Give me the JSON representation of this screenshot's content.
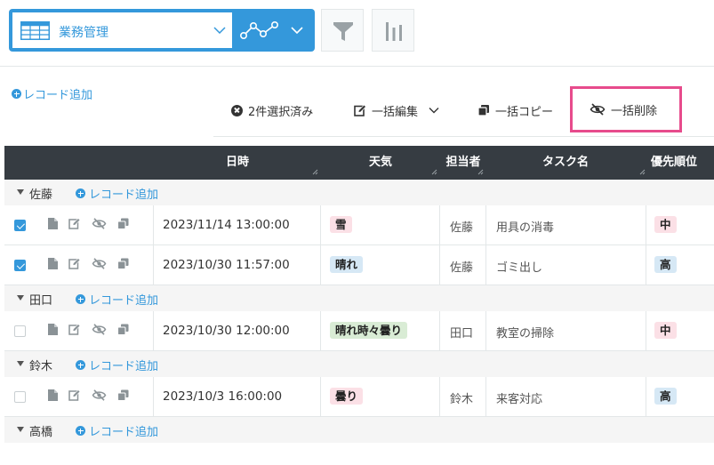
{
  "toolbar": {
    "view_name": "業務管理"
  },
  "add_record_label": "レコード追加",
  "bulk_actions": {
    "selected": "2件選択済み",
    "edit": "一括編集",
    "copy": "一括コピー",
    "delete": "一括削除"
  },
  "table": {
    "columns": [
      "日時",
      "天気",
      "担当者",
      "タスク名",
      "優先順位"
    ],
    "groups": [
      {
        "name": "佐藤",
        "add_label": "レコード追加",
        "rows": [
          {
            "checked": true,
            "datetime": "2023/11/14 13:00:00",
            "weather": "雪",
            "weather_color": "#fbe0e6",
            "person": "佐藤",
            "task": "用具の消毒",
            "priority": "中",
            "priority_color": "#fbe0e6"
          },
          {
            "checked": true,
            "datetime": "2023/10/30 11:57:00",
            "weather": "晴れ",
            "weather_color": "#d6e8f5",
            "person": "佐藤",
            "task": "ゴミ出し",
            "priority": "高",
            "priority_color": "#d6e8f5"
          }
        ]
      },
      {
        "name": "田口",
        "add_label": "レコード追加",
        "rows": [
          {
            "checked": false,
            "datetime": "2023/10/30 12:00:00",
            "weather": "晴れ時々曇り",
            "weather_color": "#d9ecd5",
            "person": "田口",
            "task": "教室の掃除",
            "priority": "中",
            "priority_color": "#fbe0e6"
          }
        ]
      },
      {
        "name": "鈴木",
        "add_label": "レコード追加",
        "rows": [
          {
            "checked": false,
            "datetime": "2023/10/3 16:00:00",
            "weather": "曇り",
            "weather_color": "#fbe0e6",
            "person": "鈴木",
            "task": "来客対応",
            "priority": "高",
            "priority_color": "#d6e8f5"
          }
        ]
      },
      {
        "name": "高橋",
        "add_label": "レコード追加",
        "rows": []
      }
    ]
  },
  "colors": {
    "accent": "#3498db",
    "highlight_border": "#e74b8c",
    "header_bg": "#363c42"
  }
}
